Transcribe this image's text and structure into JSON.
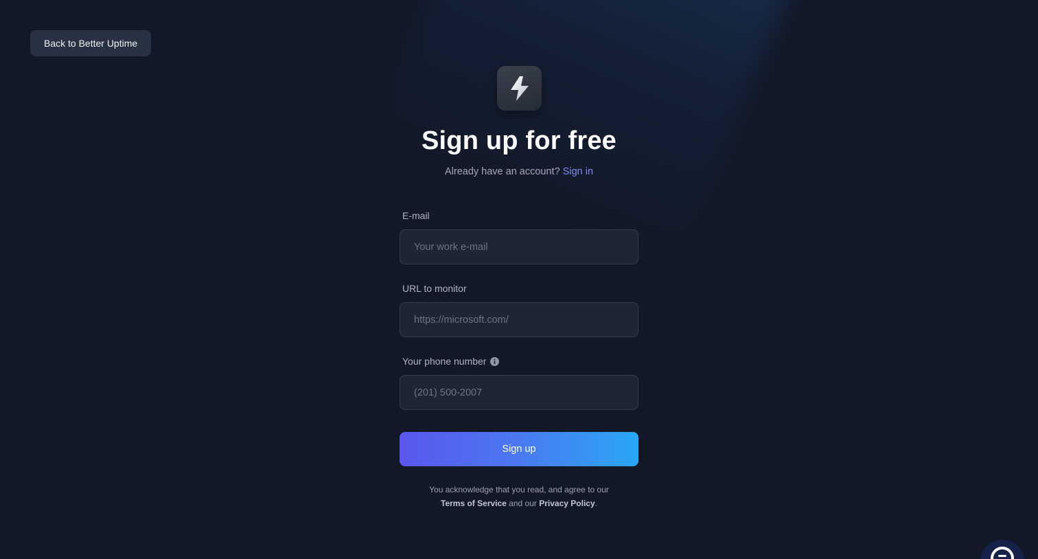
{
  "nav": {
    "back_label": "Back to Better Uptime"
  },
  "logo": {
    "icon": "lightning-bolt-icon"
  },
  "header": {
    "title": "Sign up for free",
    "subtitle_prefix": "Already have an account?",
    "signin_link": "Sign in"
  },
  "form": {
    "email": {
      "label": "E-mail",
      "placeholder": "Your work e-mail",
      "value": ""
    },
    "url": {
      "label": "URL to monitor",
      "placeholder": "https://microsoft.com/",
      "value": ""
    },
    "phone": {
      "label": "Your phone number",
      "placeholder": "(201) 500-2007",
      "value": "",
      "info_icon": "info-icon"
    },
    "submit_label": "Sign up"
  },
  "legal": {
    "line1": "You acknowledge that you read, and agree to our",
    "terms": "Terms of Service",
    "and_our": "and our",
    "privacy": "Privacy Policy",
    "period": "."
  },
  "chat": {
    "icon": "chat-bubble-icon"
  },
  "colors": {
    "background": "#121827",
    "accent_link": "#7c8cf5",
    "button_gradient_start": "#5a56ee",
    "button_gradient_end": "#2aa7f5"
  }
}
